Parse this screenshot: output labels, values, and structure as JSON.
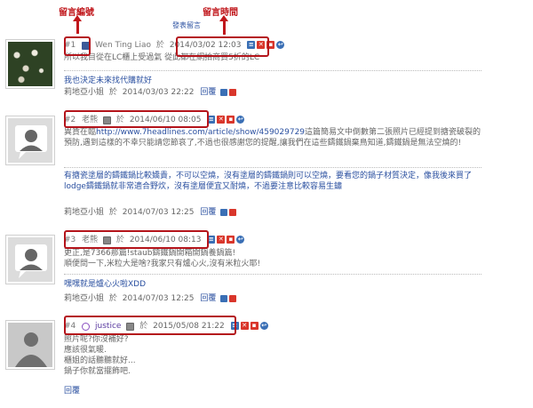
{
  "annotations": {
    "comment_number": "留言編號",
    "comment_time": "留言時間"
  },
  "header": {
    "post_comment": "發表留言"
  },
  "comments": [
    {
      "number": "#1",
      "author": "Wen Ting Liao",
      "author_suffix": "於",
      "date": "2014/03/02 12:03",
      "body": "所以我目從在LC櫃上受過氣 從此都在網拍商買5折的LC",
      "reply_text": "我也決定未來找代購就好",
      "reply_author": "莉地亞小姐",
      "reply_at": "於",
      "reply_date": "2014/03/03 22:22",
      "reply_label": "回覆"
    },
    {
      "number": "#2",
      "author": "老熊",
      "author_suffix": "於",
      "date": "2014/06/10 08:05",
      "body_prefix": "異貨在臨",
      "body_link": "http://www.7headlines.com/article/show/459029729",
      "body_rest": "這篇簡易文中倒數第二張照片已經提到搪瓷破裂的預防,遇到這樣的不幸只能請您節哀了,不過也很感謝您的提醒,讓我們在這些鑄鐵鍋棄鳥知道,鑄鐵鍋是無法空燒的!",
      "reply_text": "有搪瓷塗層的鑄鐵鍋比較嬌貴，不可以空燒，沒有塗層的鑄鐵鍋則可以空燒，要看您的鍋子材質決定，像我後來買了lodge鑄鐵鍋就非常適合野炊，沒有塗層便宜又耐燒，不過要注意比較容易生鏽",
      "reply_author": "莉地亞小姐",
      "reply_at": "於",
      "reply_date": "2014/07/03 12:25",
      "reply_label": "回覆"
    },
    {
      "number": "#3",
      "author": "老熊",
      "author_suffix": "於",
      "date": "2014/06/10 08:13",
      "body": "更正,是7366那篇!staub鑄鐵鍋開箱開鍋養鍋篇!\n順便問一下,米粒大是啥?我家只有爐心火,沒有米粒火耶!",
      "reply_text": "嘿嘿就是爐心火啦XDD",
      "reply_author": "莉地亞小姐",
      "reply_at": "於",
      "reply_date": "2014/07/03 12:25",
      "reply_label": "回覆"
    },
    {
      "number": "#4",
      "author": "justice",
      "author_suffix": "於",
      "date": "2015/05/08 21:22",
      "body": "照片呢?你沒補好?\n應該很氣暖.\n櫃姐的話聽聽就好...\n鍋子你就當擺飾吧.",
      "reply_label": "回覆"
    }
  ]
}
